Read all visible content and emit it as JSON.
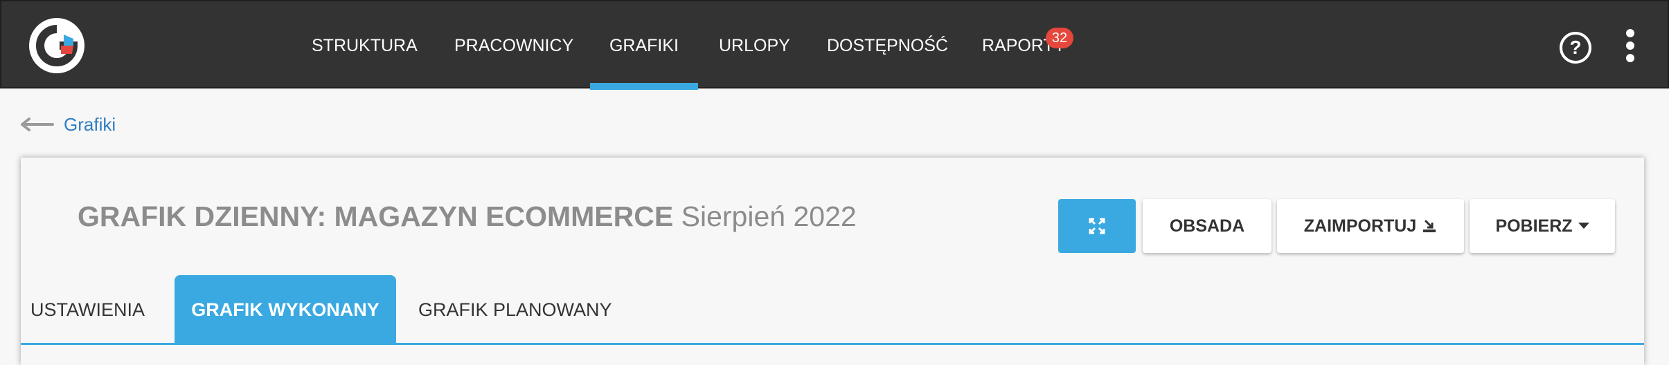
{
  "nav": {
    "items": [
      {
        "label": "STRUKTURA"
      },
      {
        "label": "PRACOWNICY"
      },
      {
        "label": "GRAFIKI"
      },
      {
        "label": "URLOPY"
      },
      {
        "label": "DOSTĘPNOŚĆ"
      },
      {
        "label": "RAPORTY"
      }
    ],
    "active": "GRAFIKI",
    "reports_badge": "32"
  },
  "header": {
    "help_icon": "?",
    "menu_icon": "kebab-menu-icon"
  },
  "breadcrumb": {
    "back_label": "Grafiki"
  },
  "page": {
    "title_main": "GRAFIK DZIENNY: MAGAZYN ECOMMERCE",
    "title_month": "Sierpień 2022"
  },
  "toolbar": {
    "fullscreen_icon": "expand-icon",
    "obsada_label": "OBSADA",
    "import_label": "ZAIMPORTUJ",
    "import_icon": "import-icon",
    "download_label": "POBIERZ",
    "download_icon": "caret-down-icon"
  },
  "tabs": [
    {
      "label": "USTAWIENIA"
    },
    {
      "label": "GRAFIK WYKONANY"
    },
    {
      "label": "GRAFIK PLANOWANY"
    }
  ],
  "colors": {
    "topbar": "#333333",
    "accent": "#3ba9e1",
    "badge": "#e5473c",
    "link": "#2f7ec3",
    "logo_red": "#e5473c",
    "logo_blue": "#3ba9e1"
  }
}
